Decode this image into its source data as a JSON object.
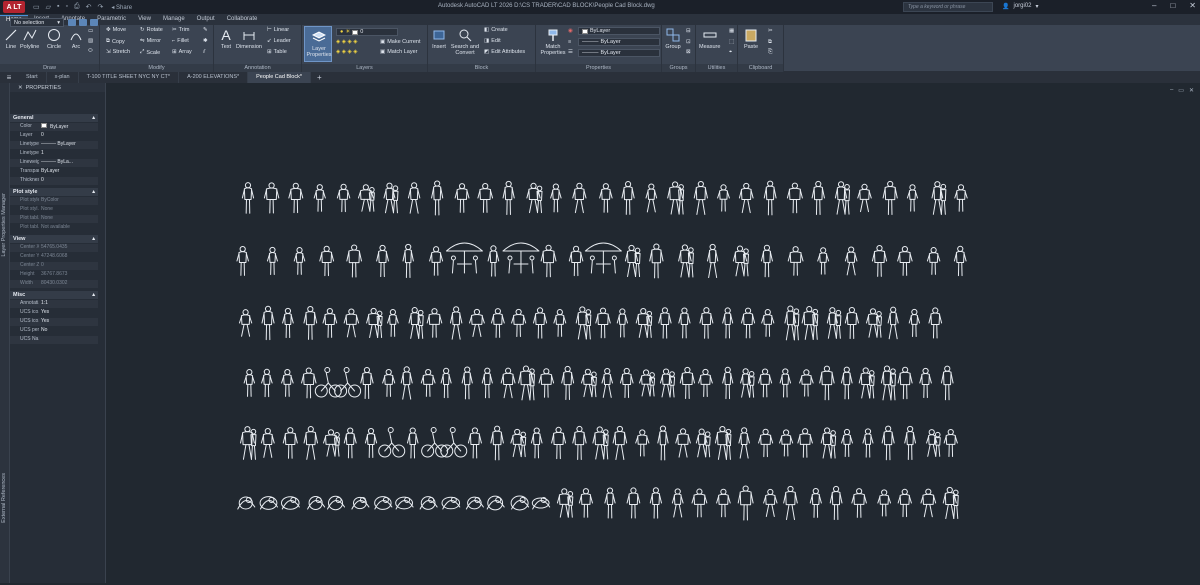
{
  "titlebar": {
    "app_badge": "A LT",
    "share_label": "Share",
    "window_title": "Autodesk AutoCAD LT 2026   D:\\CS TRADER\\CAD BLOCK\\People Cad Block.dwg",
    "search_placeholder": "Type a keyword or phrase",
    "username": "jorgi02"
  },
  "ribbon_tabs": [
    "Home",
    "Insert",
    "Annotate",
    "Parametric",
    "View",
    "Manage",
    "Output",
    "Collaborate"
  ],
  "ribbon": {
    "draw": {
      "title": "Draw",
      "line": "Line",
      "polyline": "Polyline",
      "circle": "Circle",
      "arc": "Arc"
    },
    "modify": {
      "title": "Modify",
      "move": "Move",
      "rotate": "Rotate",
      "trim": "Trim",
      "copy": "Copy",
      "mirror": "Mirror",
      "fillet": "Fillet",
      "stretch": "Stretch",
      "scale": "Scale",
      "array": "Array"
    },
    "annotation": {
      "title": "Annotation",
      "text": "Text",
      "dimension": "Dimension",
      "linear": "Linear",
      "leader": "Leader",
      "table": "Table"
    },
    "layers": {
      "title": "Layers",
      "layer_properties": "Layer Properties",
      "current_layer": "0",
      "make_current": "Make Current",
      "match_layer": "Match Layer"
    },
    "block": {
      "title": "Block",
      "insert": "Insert",
      "search_convert": "Search and Convert",
      "create": "Create",
      "edit": "Edit",
      "edit_attributes": "Edit Attributes"
    },
    "properties": {
      "title": "Properties",
      "match": "Match Properties",
      "color": "ByLayer",
      "linetype": "ByLayer",
      "lineweight": "ByLayer"
    },
    "groups": {
      "title": "Groups",
      "group": "Group"
    },
    "utilities": {
      "title": "Utilities",
      "measure": "Measure"
    },
    "clipboard": {
      "title": "Clipboard",
      "paste": "Paste"
    }
  },
  "doc_tabs": [
    "Start",
    "x-plan",
    "T-100 TITLE SHEET NYC NY CT*",
    "A-200 ELEVATIONS*",
    "People Cad Block*"
  ],
  "active_doc_tab": 4,
  "side_labels": {
    "layer_manager": "Layer Properties Manager",
    "external_refs": "External References"
  },
  "properties_palette": {
    "header": "PROPERTIES",
    "selection": "No selection",
    "sections": {
      "general": "General",
      "plot_style": "Plot style",
      "view": "View",
      "misc": "Misc"
    },
    "general": [
      {
        "k": "Color",
        "v": "ByLayer"
      },
      {
        "k": "Layer",
        "v": "0"
      },
      {
        "k": "Linetype",
        "v": "——— ByLayer"
      },
      {
        "k": "Linetype...",
        "v": "1"
      },
      {
        "k": "Lineweig...",
        "v": "——— ByLa..."
      },
      {
        "k": "Transpar...",
        "v": "ByLayer"
      },
      {
        "k": "Thickness",
        "v": "0"
      }
    ],
    "plot_style": [
      {
        "k": "Plot style",
        "v": "ByColor"
      },
      {
        "k": "Plot styl...",
        "v": "None"
      },
      {
        "k": "Plot tabl...",
        "v": "None"
      },
      {
        "k": "Plot tabl...",
        "v": "Not available"
      }
    ],
    "view": [
      {
        "k": "Center X",
        "v": "54765.0435"
      },
      {
        "k": "Center Y",
        "v": "47248.6068"
      },
      {
        "k": "Center Z",
        "v": "0"
      },
      {
        "k": "Height",
        "v": "36767.8673"
      },
      {
        "k": "Width",
        "v": "80430.0302"
      }
    ],
    "misc": [
      {
        "k": "Annotati...",
        "v": "1:1"
      },
      {
        "k": "UCS ico...",
        "v": "Yes"
      },
      {
        "k": "UCS ico...",
        "v": "Yes"
      },
      {
        "k": "UCS per...",
        "v": "No"
      },
      {
        "k": "UCS Na...",
        "v": ""
      }
    ]
  },
  "canvas": {
    "figure_rows": 6,
    "figures_per_row": [
      31,
      27,
      34,
      36,
      35,
      32
    ]
  }
}
